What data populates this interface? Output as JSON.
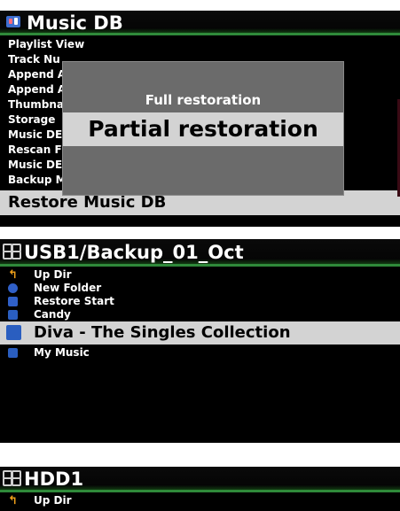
{
  "colors": {
    "accent_green": "#2f8a3a",
    "selection": "#d3d3d3",
    "panel_bg": "#000000",
    "popup_bg": "#6b6b6b"
  },
  "panel1": {
    "icon": "music-db-icon",
    "title": "Music DB",
    "items": [
      {
        "label": "Playlist View"
      },
      {
        "label": "Track Nu"
      },
      {
        "label": "Append A"
      },
      {
        "label": "Append A"
      },
      {
        "label": "Thumbna"
      },
      {
        "label": "Storage"
      },
      {
        "label": "Music DE"
      },
      {
        "label": "Rescan F"
      },
      {
        "label": "Music DE"
      },
      {
        "label": "Backup Music DB"
      }
    ],
    "selected": "Restore Music DB",
    "popup": {
      "options": [
        "Full restoration",
        "Partial restoration"
      ],
      "selected_index": 1
    }
  },
  "panel2": {
    "icon": "storage-grid-icon",
    "title": "USB1/Backup_01_Oct",
    "items": [
      {
        "label": "Up Dir",
        "icon": "up-dir-icon"
      },
      {
        "label": "New Folder",
        "icon": "new-folder-icon"
      },
      {
        "label": "Restore Start",
        "icon": "restore-start-icon"
      },
      {
        "label": "Candy",
        "icon": "music-folder-icon"
      },
      {
        "label": "Diva - The Singles Collection",
        "icon": "music-folder-icon",
        "selected": true
      },
      {
        "label": "My Music",
        "icon": "music-folder-icon"
      }
    ]
  },
  "panel3": {
    "icon": "storage-grid-icon",
    "title": "HDD1",
    "items": [
      {
        "label": "Up Dir",
        "icon": "up-dir-icon"
      }
    ]
  }
}
